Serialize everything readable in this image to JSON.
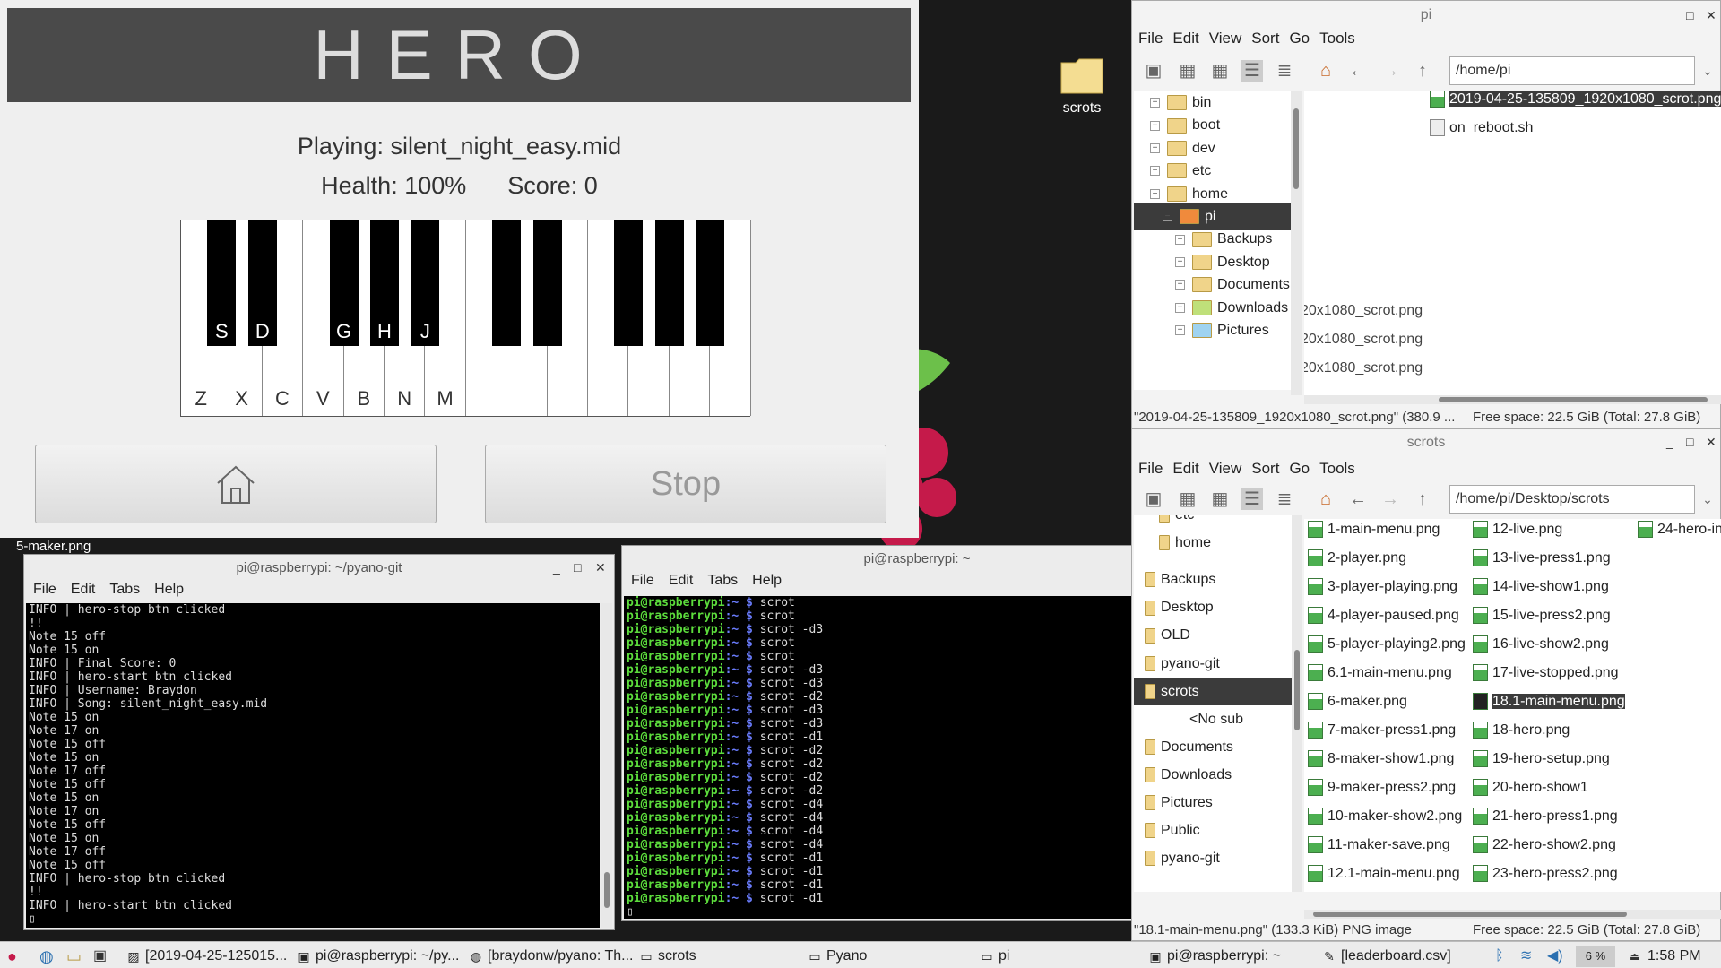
{
  "desktop": {
    "icon_label": "scrots",
    "fragment_label": "5-maker.png"
  },
  "hero": {
    "title": "HERO",
    "playing": "Playing: silent_night_easy.mid",
    "health": "Health: 100%",
    "score": "Score: 0",
    "white_key_labels": [
      "Z",
      "X",
      "C",
      "V",
      "B",
      "N",
      "M"
    ],
    "black_key_labels": [
      "S",
      "D",
      "G",
      "H",
      "J"
    ],
    "home_icon": "home-icon",
    "stop_label": "Stop"
  },
  "term1": {
    "title": "pi@raspberrypi: ~/pyano-git",
    "menu": [
      "File",
      "Edit",
      "Tabs",
      "Help"
    ],
    "lines": [
      "INFO | hero-stop btn clicked",
      "!!",
      "Note 15 off",
      "Note 15 on",
      "INFO | Final Score: 0",
      "INFO | hero-start btn clicked",
      "INFO | Username: Braydon",
      "INFO | Song: silent_night_easy.mid",
      "Note 15 on",
      "Note 17 on",
      "Note 15 off",
      "Note 15 on",
      "Note 17 off",
      "Note 15 off",
      "Note 15 on",
      "Note 17 on",
      "Note 15 off",
      "Note 15 on",
      "Note 17 off",
      "Note 15 off",
      "INFO | hero-stop btn clicked",
      "!!",
      "INFO | hero-start btn clicked"
    ]
  },
  "term2": {
    "title": "pi@raspberrypi: ~",
    "menu": [
      "File",
      "Edit",
      "Tabs",
      "Help"
    ],
    "prompt_host": "pi@raspberrypi",
    "prompt_path": ":~ $",
    "commands": [
      "scrot",
      "scrot",
      "scrot -d3",
      "scrot",
      "scrot",
      "scrot -d3",
      "scrot -d3",
      "scrot -d2",
      "scrot -d3",
      "scrot -d3",
      "scrot -d1",
      "scrot -d2",
      "scrot -d2",
      "scrot -d2",
      "scrot -d2",
      "scrot -d4",
      "scrot -d4",
      "scrot -d4",
      "scrot -d4",
      "scrot -d1",
      "scrot -d1",
      "scrot -d1",
      "scrot -d1"
    ]
  },
  "fm1": {
    "title": "pi",
    "menu": [
      "File",
      "Edit",
      "View",
      "Sort",
      "Go",
      "Tools"
    ],
    "path": "/home/pi",
    "tree": [
      {
        "label": "bin",
        "exp": "+",
        "indent": 0
      },
      {
        "label": "boot",
        "exp": "+",
        "indent": 0
      },
      {
        "label": "dev",
        "exp": "+",
        "indent": 0
      },
      {
        "label": "etc",
        "exp": "+",
        "indent": 0
      },
      {
        "label": "home",
        "exp": "−",
        "indent": 0
      },
      {
        "label": "pi",
        "exp": "−",
        "indent": 1,
        "selected": true
      },
      {
        "label": "Backups",
        "exp": "+",
        "indent": 2
      },
      {
        "label": "Desktop",
        "exp": "+",
        "indent": 2
      },
      {
        "label": "Documents",
        "exp": "+",
        "indent": 2
      },
      {
        "label": "Downloads",
        "exp": "+",
        "indent": 2
      },
      {
        "label": "Pictures",
        "exp": "+",
        "indent": 2
      }
    ],
    "files": [
      {
        "label": "2019-04-25-135809_1920x1080_scrot.png",
        "selected": true
      },
      {
        "label": "on_reboot.sh"
      }
    ],
    "ghost_files": [
      "20x1080_scrot.png",
      "20x1080_scrot.png",
      "20x1080_scrot.png"
    ],
    "status_left": "\"2019-04-25-135809_1920x1080_scrot.png\" (380.9 ...",
    "status_right": "Free space: 22.5 GiB (Total: 27.8 GiB)"
  },
  "fm2": {
    "title": "scrots",
    "menu": [
      "File",
      "Edit",
      "View",
      "Sort",
      "Go",
      "Tools"
    ],
    "path": "/home/pi/Desktop/scrots",
    "tree": [
      "etc",
      "home",
      "Backups",
      "Desktop",
      "OLD",
      "pyano-git",
      "scrots",
      "<No sub",
      "Documents",
      "Downloads",
      "Pictures",
      "Public",
      "pyano-git"
    ],
    "col1": [
      "1-main-menu.png",
      "2-player.png",
      "3-player-playing.png",
      "4-player-paused.png",
      "5-player-playing2.png",
      "6.1-main-menu.png",
      "6-maker.png",
      "7-maker-press1.png",
      "8-maker-show1.png",
      "9-maker-press2.png",
      "10-maker-show2.png",
      "11-maker-save.png",
      "12.1-main-menu.png"
    ],
    "col2": [
      "12-live.png",
      "13-live-press1.png",
      "14-live-show1.png",
      "15-live-press2.png",
      "16-live-show2.png",
      "17-live-stopped.png",
      "18.1-main-menu.png",
      "18-hero.png",
      "19-hero-setup.png",
      "20-hero-show1",
      "21-hero-press1.png",
      "22-hero-show2.png",
      "23-hero-press2.png"
    ],
    "col3": [
      "24-hero-in"
    ],
    "status_left": "\"18.1-main-menu.png\" (133.3 KiB) PNG image",
    "status_right": "Free space: 22.5 GiB (Total: 27.8 GiB)"
  },
  "taskbar": {
    "items": [
      {
        "label": "[2019-04-25-125015...",
        "icon": "image-viewer-icon"
      },
      {
        "label": "pi@raspberrypi: ~/py...",
        "icon": "terminal-icon"
      },
      {
        "label": "[braydonw/pyano: Th...",
        "icon": "browser-icon"
      },
      {
        "label": "scrots",
        "icon": "folder-icon"
      },
      {
        "label": "Pyano",
        "icon": "window-icon"
      },
      {
        "label": "pi",
        "icon": "folder-icon"
      },
      {
        "label": "pi@raspberrypi: ~",
        "icon": "terminal-icon"
      },
      {
        "label": "[leaderboard.csv]",
        "icon": "editor-icon"
      }
    ],
    "cpu": "6 %",
    "clock": "1:58 PM"
  }
}
